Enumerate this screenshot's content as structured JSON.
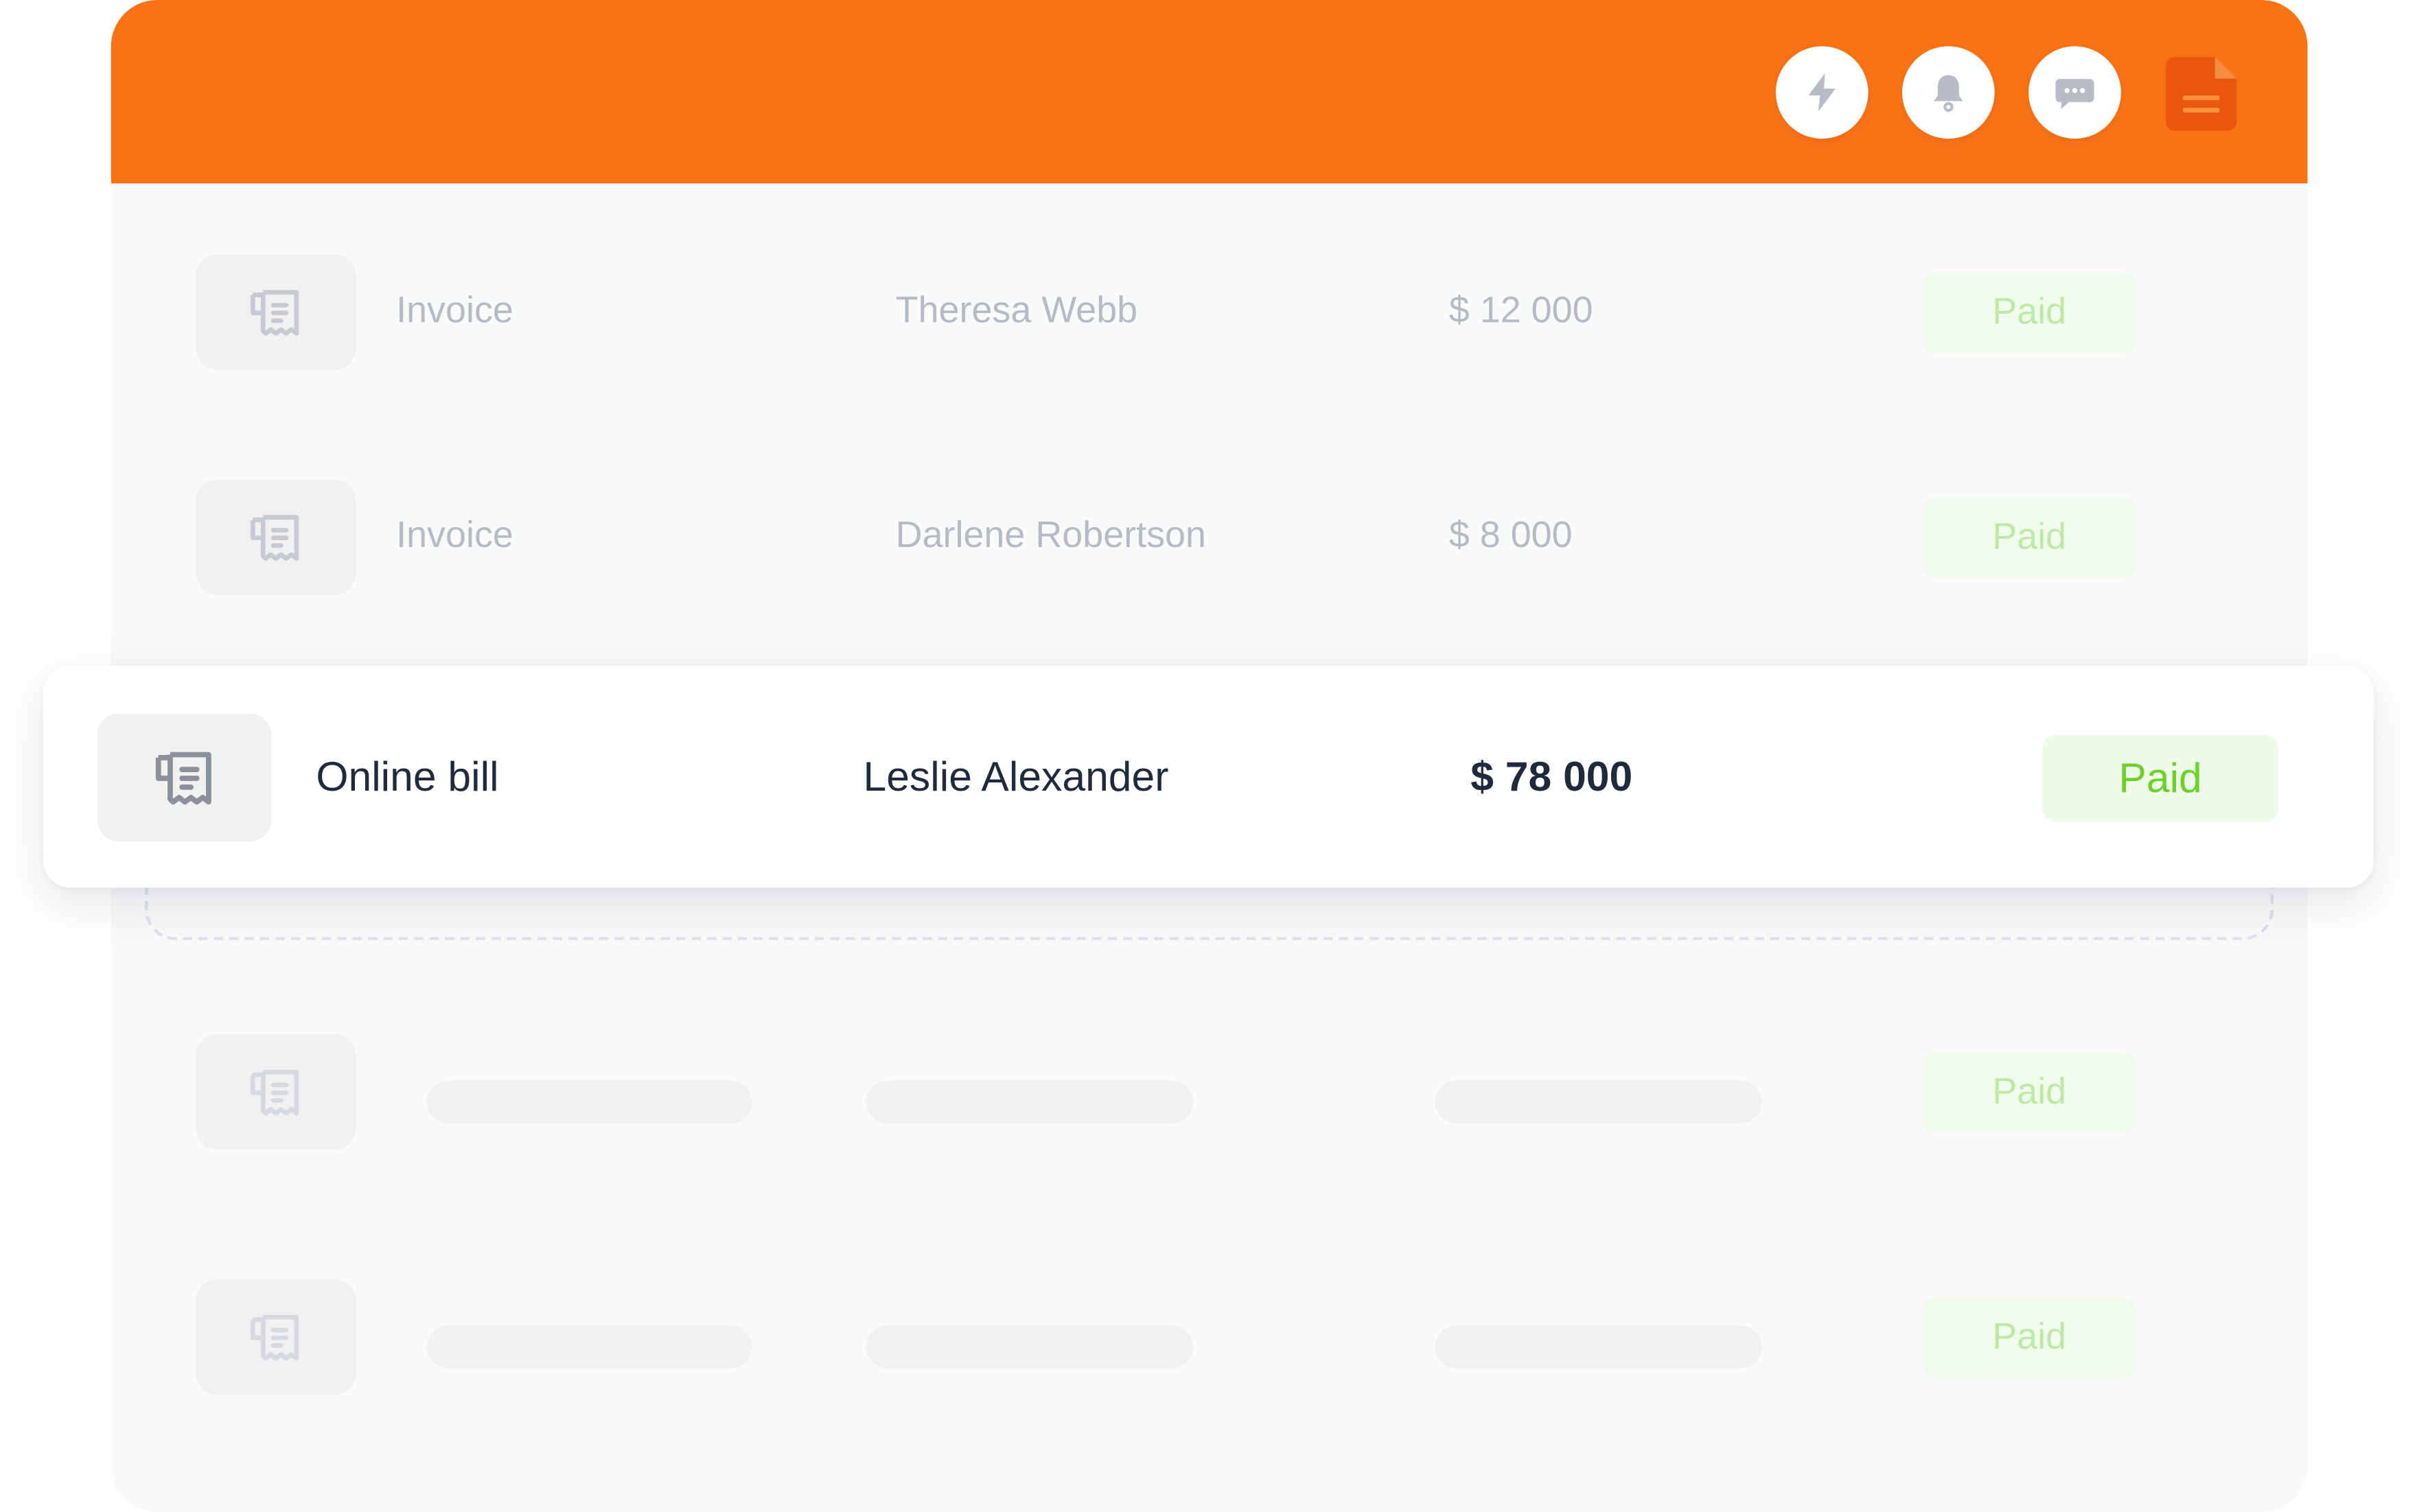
{
  "header": {
    "accent_color": "#f97316",
    "icons": [
      "lightning-icon",
      "bell-icon",
      "chat-icon",
      "document-icon"
    ]
  },
  "rows": [
    {
      "type": "Invoice",
      "name": "Theresa Webb",
      "amount": "$ 12 000",
      "status": "Paid"
    },
    {
      "type": "Invoice",
      "name": "Darlene Robertson",
      "amount": "$ 8 000",
      "status": "Paid"
    },
    {
      "type": "",
      "name": "",
      "amount": "",
      "status": "Paid"
    },
    {
      "type": "",
      "name": "",
      "amount": "",
      "status": "Paid"
    }
  ],
  "active_row": {
    "type": "Online bill",
    "name": "Leslie Alexander",
    "amount": "$ 78 000",
    "status": "Paid"
  },
  "colors": {
    "paid_text": "#6bd12a",
    "paid_bg": "#eefbe6",
    "text_dark": "#1f2a3c",
    "text_muted": "#b6bbc3"
  }
}
